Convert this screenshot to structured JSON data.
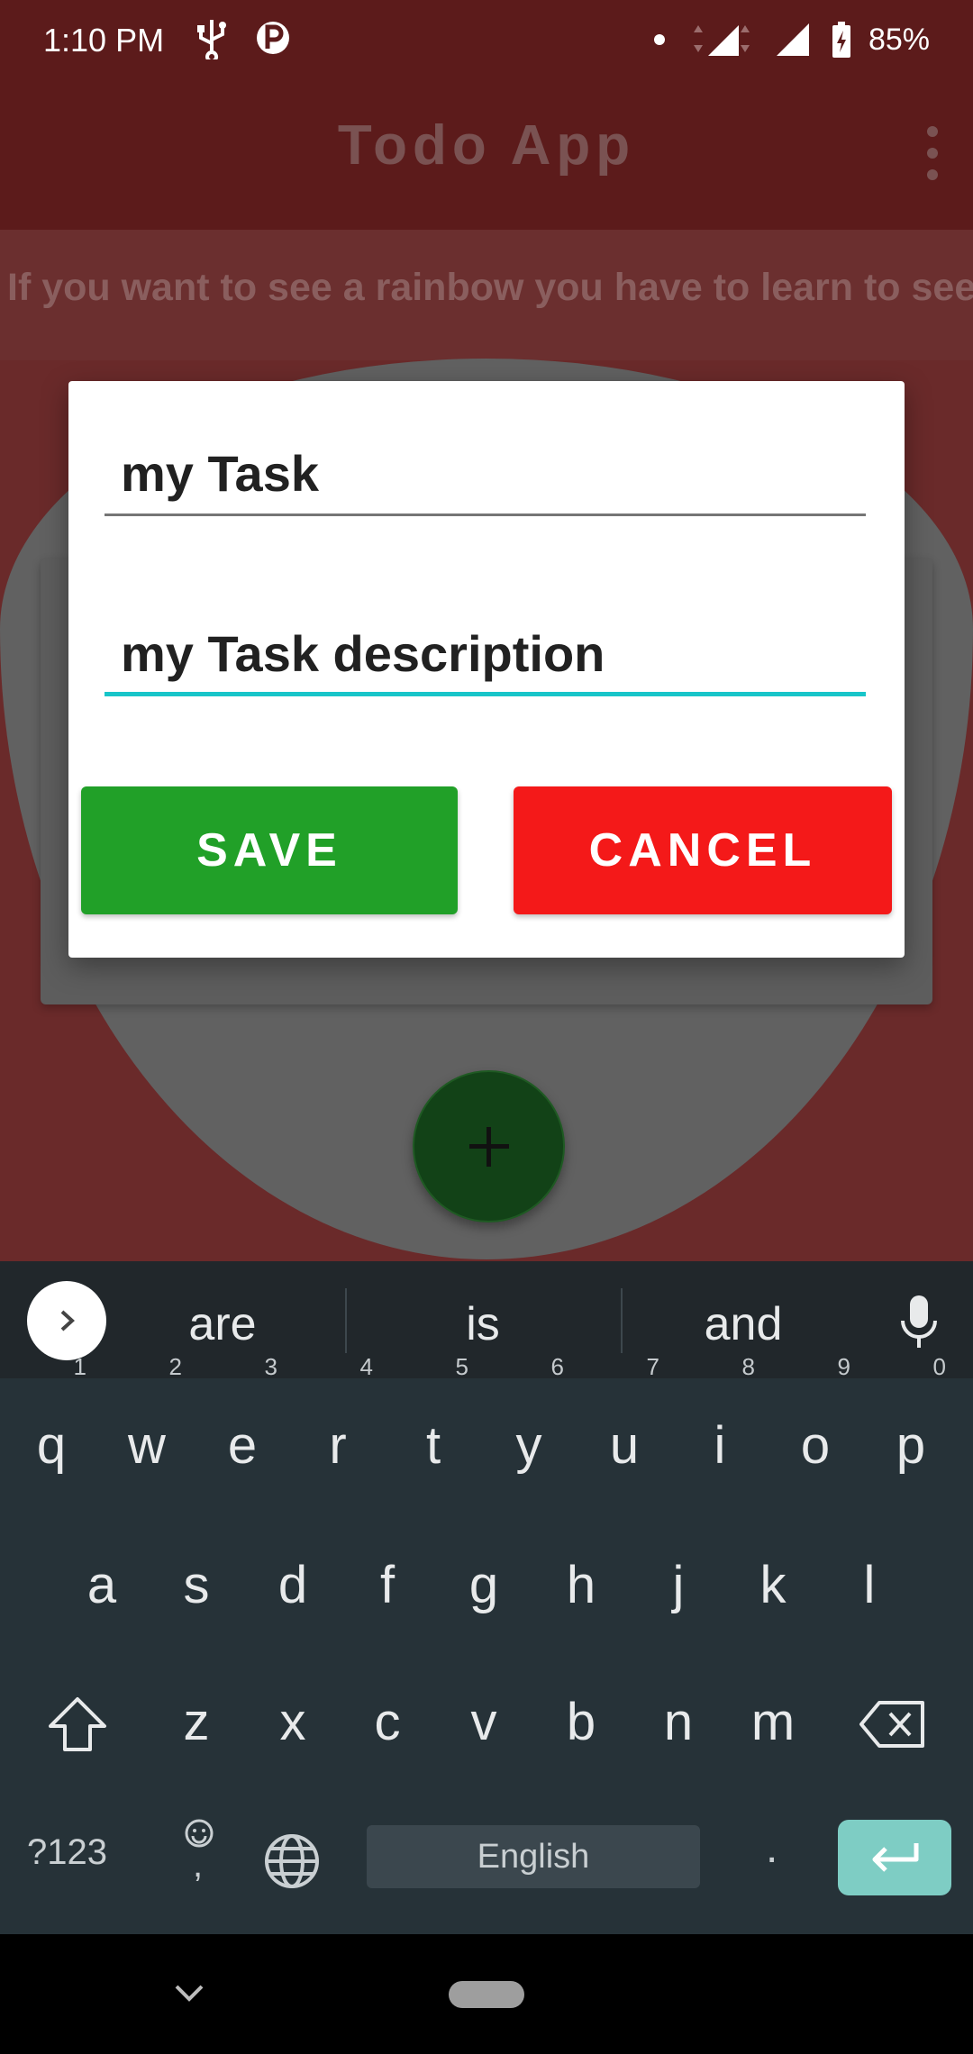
{
  "status_bar": {
    "time": "1:10 PM",
    "battery_percent": "85%",
    "icons": [
      "usb-icon",
      "parking-icon",
      "dot-icon",
      "signal-icon",
      "signal-icon",
      "battery-charging-icon"
    ]
  },
  "app_bar": {
    "title": "Todo App",
    "menu_icon": "overflow-menu-icon"
  },
  "quote": "If you want to see a rainbow you have to learn to see..",
  "dialog": {
    "task_title_value": "my Task",
    "task_description_value": "my Task description",
    "save_label": "SAVE",
    "cancel_label": "CANCEL"
  },
  "fab": {
    "icon": "plus-icon"
  },
  "keyboard": {
    "suggestions": [
      "are",
      "is",
      "and"
    ],
    "row1": [
      {
        "k": "q",
        "h": "1"
      },
      {
        "k": "w",
        "h": "2"
      },
      {
        "k": "e",
        "h": "3"
      },
      {
        "k": "r",
        "h": "4"
      },
      {
        "k": "t",
        "h": "5"
      },
      {
        "k": "y",
        "h": "6"
      },
      {
        "k": "u",
        "h": "7"
      },
      {
        "k": "i",
        "h": "8"
      },
      {
        "k": "o",
        "h": "9"
      },
      {
        "k": "p",
        "h": "0"
      }
    ],
    "row2": [
      "a",
      "s",
      "d",
      "f",
      "g",
      "h",
      "j",
      "k",
      "l"
    ],
    "row3": [
      "z",
      "x",
      "c",
      "v",
      "b",
      "n",
      "m"
    ],
    "symbols_label": "?123",
    "emoji_comma_label": ",",
    "space_label": "English",
    "period_label": "."
  },
  "colors": {
    "save": "#21a028",
    "cancel": "#f41919",
    "focus_underline": "#17c5c9",
    "keyboard_bg": "#263238",
    "enter_key": "#7ecdc4"
  }
}
